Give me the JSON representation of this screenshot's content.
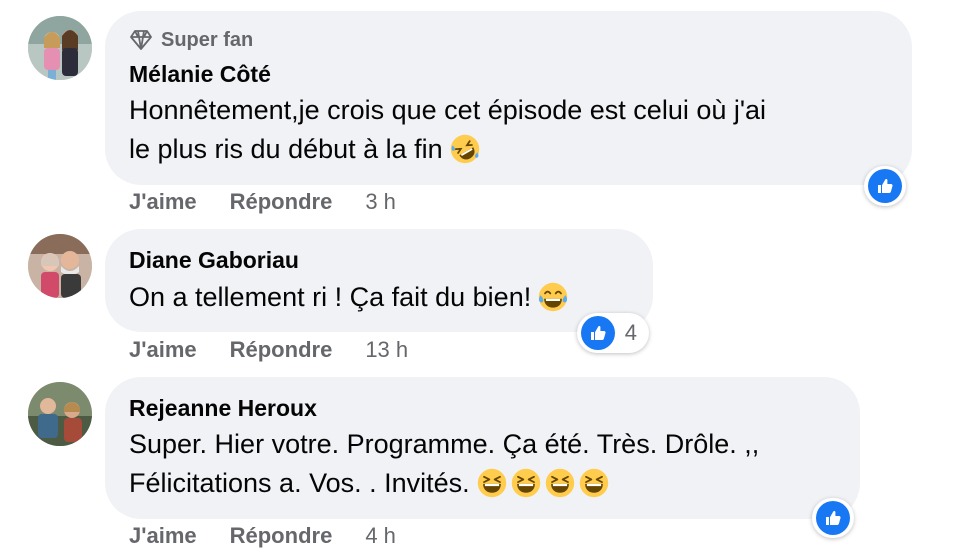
{
  "comments": [
    {
      "badge": "Super fan",
      "author": "Mélanie Côté",
      "lines": [
        "Honnêtement,je crois que cet épisode est celui où j'ai",
        "le plus ris du début à la fin"
      ],
      "emoji": "rolling-on-floor-laughing",
      "actions": {
        "like": "J'aime",
        "reply": "Répondre",
        "time": "3 h"
      },
      "reaction": {
        "icon": "like",
        "count": ""
      }
    },
    {
      "author": "Diane Gaboriau",
      "lines": [
        "On a tellement ri ! Ça fait du bien!"
      ],
      "emoji": "tears-of-joy",
      "actions": {
        "like": "J'aime",
        "reply": "Répondre",
        "time": "13 h"
      },
      "reaction": {
        "icon": "like",
        "count": "4"
      }
    },
    {
      "author": "Rejeanne Heroux",
      "lines": [
        "Super. Hier votre. Programme. Ça été. Très. Drôle. ,,",
        "Félicitations a. Vos. . Invités."
      ],
      "emoji": "grinning-squinting-x4",
      "actions": {
        "like": "J'aime",
        "reply": "Répondre",
        "time": "4 h"
      },
      "reaction": {
        "icon": "like",
        "count": ""
      }
    }
  ],
  "colors": {
    "bubble": "#f0f2f5",
    "secondary_text": "#65676b",
    "like_blue": "#1877f2",
    "emoji_yellow": "#ffcc4d"
  }
}
